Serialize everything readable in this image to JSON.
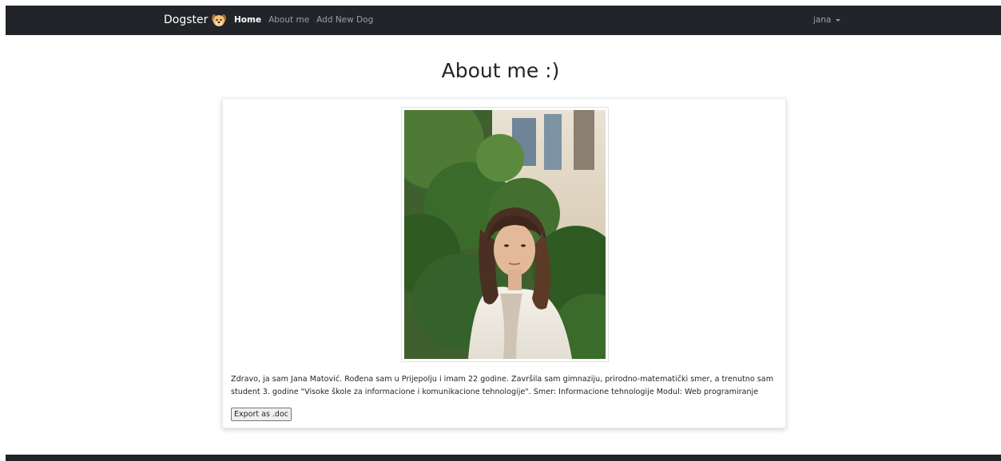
{
  "navbar": {
    "brand": "Dogster",
    "brand_icon": "dog-face-icon",
    "links": [
      {
        "label": "Home",
        "active": true
      },
      {
        "label": "About me",
        "active": false
      },
      {
        "label": "Add New Dog",
        "active": false
      }
    ],
    "user": "jana",
    "user_icon": "caret-down-icon"
  },
  "main": {
    "title": "About me :)",
    "bio": "Zdravo, ja sam Jana Matović. Rođena sam u Prijepolju i imam 22 godine. Završila sam gimnaziju, prirodno-matematički smer, a trenutno sam student 3. godine \"Visoke škole za informacione i komunikacione tehnologije\". Smer: Informacione tehnologije Modul: Web programiranje",
    "export_label": "Export as .doc"
  },
  "colors": {
    "navbar_bg": "#212529",
    "nav_active": "#ffffff",
    "nav_muted": "#8c8f92"
  }
}
